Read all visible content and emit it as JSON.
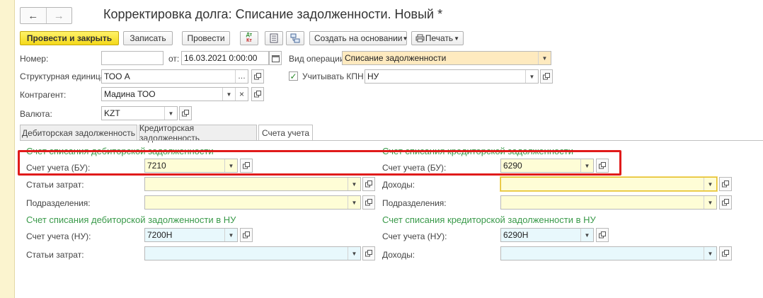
{
  "window": {
    "title": "Корректировка долга: Списание задолженности. Новый *"
  },
  "nav": {
    "back": "←",
    "forward": "→"
  },
  "toolbar": {
    "post_close": "Провести и закрыть",
    "save": "Записать",
    "post": "Провести",
    "dtkt": "Дт Кт",
    "create_based": "Создать на основании",
    "print": "Печать"
  },
  "form": {
    "number_label": "Номер:",
    "number_value": "",
    "date_label": "от:",
    "date_value": "16.03.2021 0:00:00",
    "op_type_label": "Вид операции:",
    "op_type_value": "Списание задолженности",
    "unit_label": "Структурная единица:",
    "unit_value": "ТОО А",
    "kpn_label": "Учитывать КПН",
    "kpn_checked": true,
    "kpn_value": "НУ",
    "counterparty_label": "Контрагент:",
    "counterparty_value": "Мадина ТОО",
    "currency_label": "Валюта:",
    "currency_value": "KZT"
  },
  "tabs": [
    {
      "label": "Дебиторская задолженность",
      "active": false
    },
    {
      "label": "Кредиторская задолженность",
      "active": false
    },
    {
      "label": "Счета учета",
      "active": true
    }
  ],
  "left_bu": {
    "title": "Счет списания дебиторской задолженности",
    "account_label": "Счет учета (БУ):",
    "account_value": "7210",
    "costs_label": "Статьи затрат:",
    "costs_value": "",
    "dept_label": "Подразделения:",
    "dept_value": ""
  },
  "right_bu": {
    "title": "Счет списания кредиторской задолженности",
    "account_label": "Счет учета (БУ):",
    "account_value": "6290",
    "income_label": "Доходы:",
    "income_value": "",
    "dept_label": "Подразделения:",
    "dept_value": ""
  },
  "left_nu": {
    "title": "Счет списания дебиторской задолженности в НУ",
    "account_label": "Счет учета (НУ):",
    "account_value": "7200Н",
    "costs_label": "Статьи затрат:",
    "costs_value": ""
  },
  "right_nu": {
    "title": "Счет списания кредиторской задолженности в НУ",
    "account_label": "Счет учета (НУ):",
    "account_value": "6290Н",
    "income_label": "Доходы:",
    "income_value": ""
  },
  "colors": {
    "accent_yellow": "#f4d81a",
    "section_green": "#3a9a4a",
    "highlight_red": "#e01b1b"
  }
}
